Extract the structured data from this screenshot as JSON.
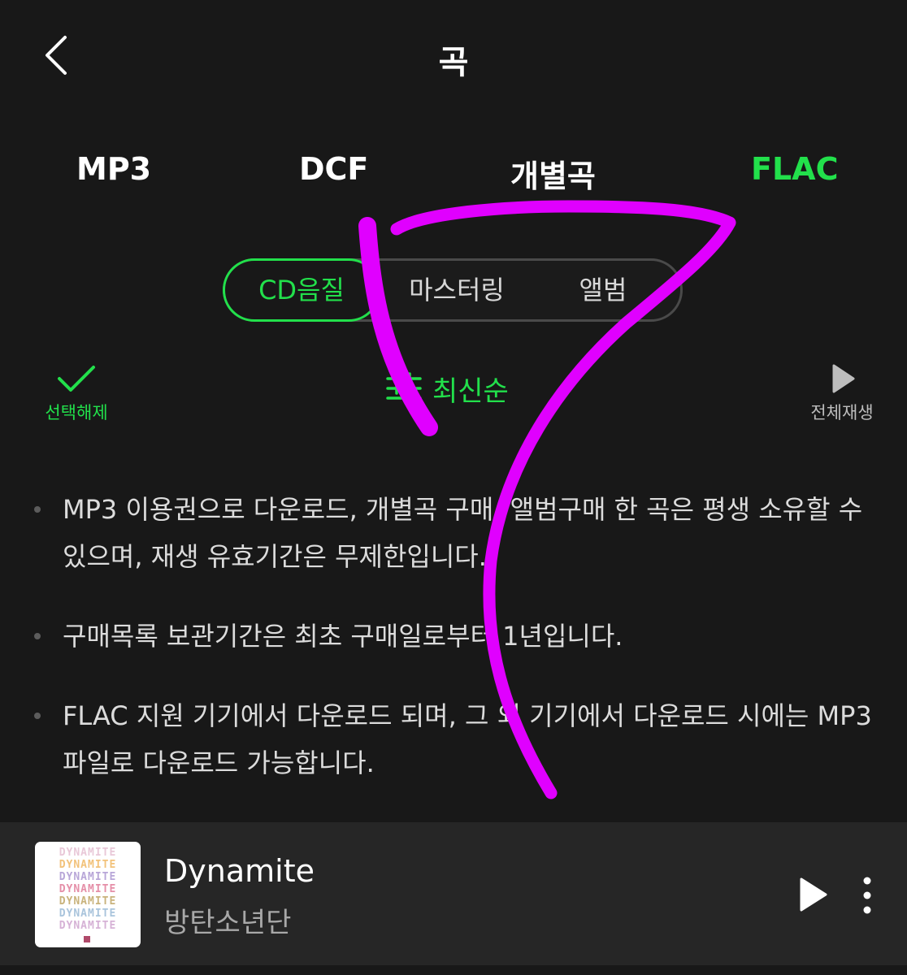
{
  "header": {
    "title": "곡"
  },
  "tabs": [
    {
      "label": "MP3",
      "active": false
    },
    {
      "label": "DCF",
      "active": false
    },
    {
      "label": "개별곡",
      "active": false
    },
    {
      "label": "FLAC",
      "active": true
    }
  ],
  "segments": [
    {
      "label": "CD음질",
      "active": true
    },
    {
      "label": "마스터링",
      "active": false
    },
    {
      "label": "앨범",
      "active": false
    }
  ],
  "actions": {
    "deselect_label": "선택해제",
    "sort_label": "최신순",
    "play_all_label": "전체재생"
  },
  "notes": [
    "MP3 이용권으로 다운로드, 개별곡 구매, 앨범구매 한 곡은 평생 소유할 수 있으며, 재생 유효기간은 무제한입니다.",
    "구매목록 보관기간은 최초 구매일로부터 1년입니다.",
    "FLAC 지원 기기에서 다운로드 되며, 그 외 기기에서 다운로드 시에는 MP3 파일로 다운로드 가능합니다."
  ],
  "player": {
    "track_title": "Dynamite",
    "artist": "방탄소년단",
    "album_art_text": "DYNAMITE"
  },
  "icons": {
    "back": "back-chevron-icon",
    "check": "check-icon",
    "sort": "sort-filter-icon",
    "play_all": "play-icon",
    "play": "play-icon",
    "more": "more-vertical-icon"
  },
  "colors": {
    "background": "#181818",
    "accent": "#22e04b",
    "player_bar": "#262626",
    "annotation": "#e000ff"
  }
}
